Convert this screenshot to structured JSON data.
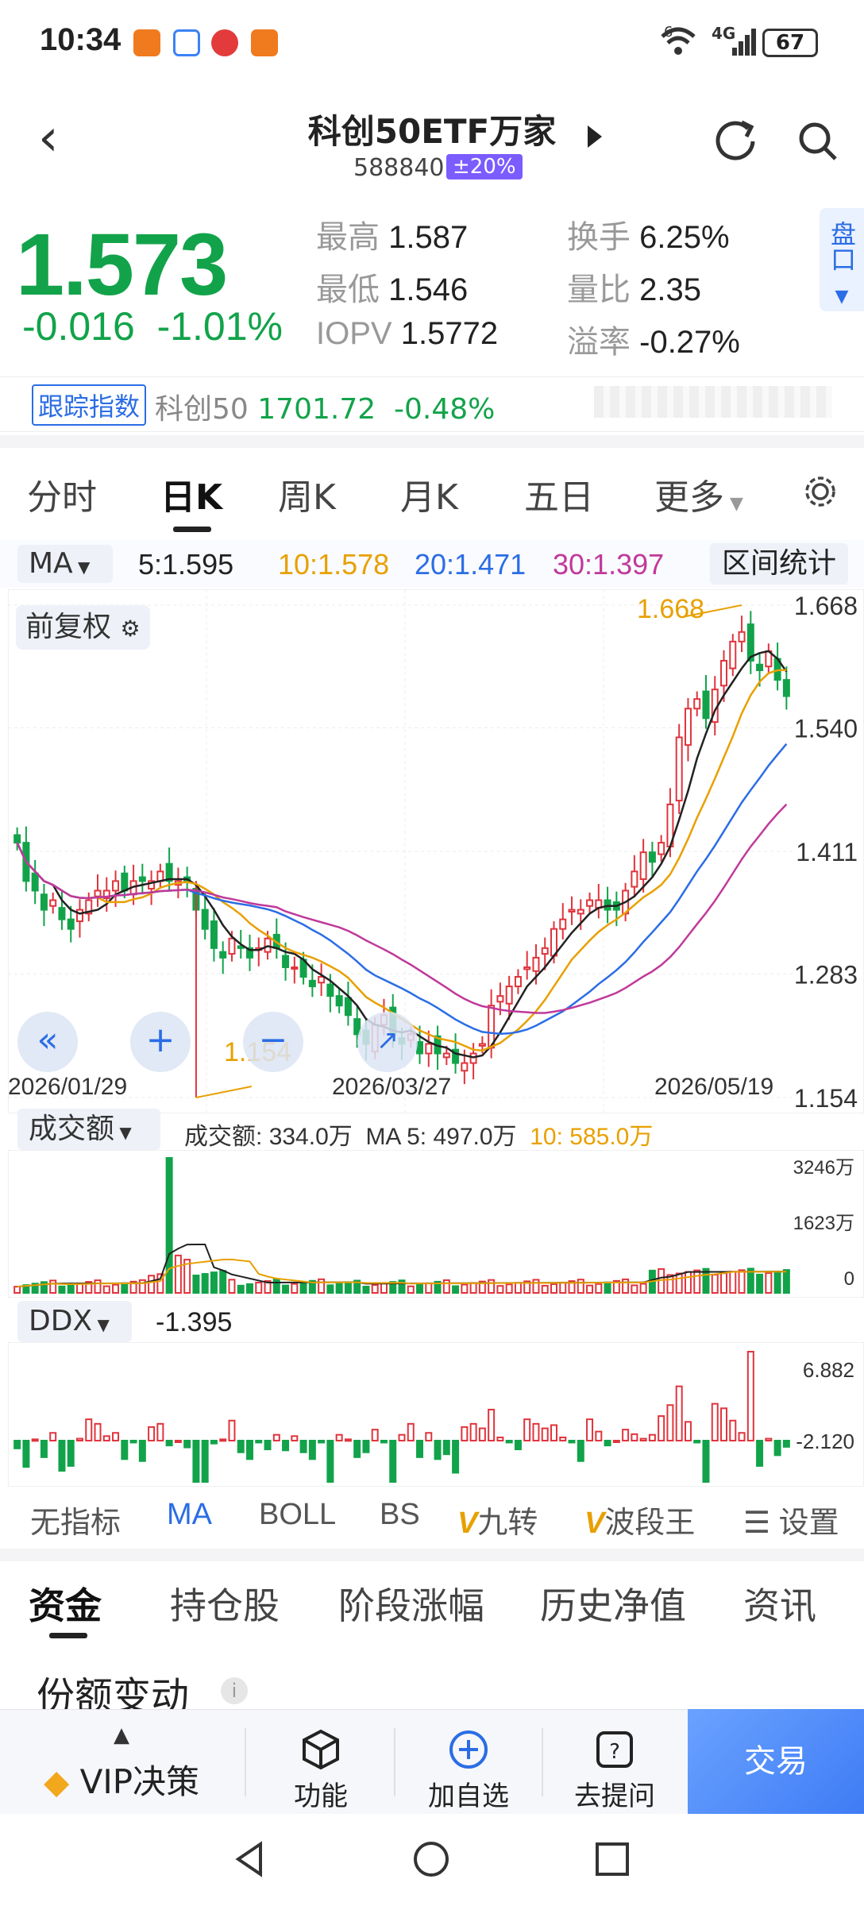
{
  "status_bar": {
    "time": "10:34",
    "network": "4G",
    "signal_label": "6",
    "battery": "67"
  },
  "header": {
    "title": "科创50ETF万家",
    "code": "588840",
    "limit_badge": "±20%"
  },
  "quote": {
    "price": "1.573",
    "change": "-0.016",
    "change_pct": "-1.01%",
    "high_label": "最高",
    "high": "1.587",
    "low_label": "最低",
    "low": "1.546",
    "iopv_label": "IOPV",
    "iopv": "1.5772",
    "turnover_label": "换手",
    "turnover": "6.25%",
    "volume_ratio_label": "量比",
    "volume_ratio": "2.35",
    "premium_label": "溢率",
    "premium": "-0.27%",
    "pankou": "盘口"
  },
  "tracking": {
    "tag": "跟踪指数",
    "index_name": "科创50",
    "index_value": "1701.72",
    "index_change": "-0.48%"
  },
  "kline_tabs": [
    "分时",
    "日K",
    "周K",
    "月K",
    "五日",
    "更多"
  ],
  "ma_bar": {
    "selector": "MA",
    "ma5": "5:1.595",
    "ma10": "10:1.578",
    "ma20": "20:1.471",
    "ma30": "30:1.397",
    "stats_button": "区间统计"
  },
  "colors": {
    "up": "#e0343c",
    "down": "#12a34a",
    "ma5": "#222222",
    "ma10": "#e8a000",
    "ma20": "#2b6de5",
    "ma30": "#c0399a",
    "accent": "#2b6de5"
  },
  "main_chart": {
    "adjust_label": "前复权",
    "y_ticks": [
      "1.668",
      "1.540",
      "1.411",
      "1.283",
      "1.154"
    ],
    "high_marker": "1.668",
    "low_marker": "1.154",
    "dates": [
      "2026/01/29",
      "2026/03/27",
      "2026/05/19"
    ]
  },
  "chart_data": {
    "type": "candlestick",
    "x_range": [
      "2026/01/29",
      "2026/05/19"
    ],
    "ylim": [
      1.154,
      1.668
    ],
    "y_ticks": [
      1.668,
      1.54,
      1.411,
      1.283,
      1.154
    ],
    "highest": 1.668,
    "lowest": 1.154,
    "close": [
      1.42,
      1.38,
      1.37,
      1.35,
      1.36,
      1.34,
      1.33,
      1.35,
      1.36,
      1.37,
      1.37,
      1.38,
      1.37,
      1.38,
      1.38,
      1.38,
      1.39,
      1.38,
      1.38,
      1.38,
      1.35,
      1.33,
      1.31,
      1.3,
      1.32,
      1.31,
      1.3,
      1.31,
      1.32,
      1.31,
      1.29,
      1.29,
      1.28,
      1.27,
      1.28,
      1.26,
      1.25,
      1.24,
      1.22,
      1.21,
      1.23,
      1.24,
      1.22,
      1.21,
      1.22,
      1.2,
      1.21,
      1.2,
      1.2,
      1.19,
      1.19,
      1.2,
      1.21,
      1.25,
      1.26,
      1.27,
      1.28,
      1.29,
      1.3,
      1.31,
      1.33,
      1.34,
      1.35,
      1.35,
      1.36,
      1.36,
      1.35,
      1.35,
      1.37,
      1.39,
      1.41,
      1.4,
      1.42,
      1.46,
      1.53,
      1.56,
      1.57,
      1.55,
      1.58,
      1.61,
      1.63,
      1.64,
      1.61,
      1.6,
      1.62,
      1.59,
      1.573
    ]
  },
  "volume": {
    "selector": "成交额",
    "label": "成交额:",
    "value": "334.0万",
    "ma5_label": "MA 5:",
    "ma5": "497.0万",
    "ma10_label": "10:",
    "ma10": "585.0万",
    "y_ticks": [
      "3246万",
      "1623万",
      "0"
    ]
  },
  "ddx": {
    "selector": "DDX",
    "value": "-1.395",
    "y_ticks": [
      "6.882",
      "-2.120"
    ]
  },
  "indicator_tabs": {
    "none": "无指标",
    "ma": "MA",
    "boll": "BOLL",
    "bs": "BS",
    "jiuzhuan": "九转",
    "boduanwang": "波段王",
    "settings": "设置",
    "v_mark": "V"
  },
  "bottom_tabs": [
    "资金",
    "持仓股",
    "阶段涨幅",
    "历史净值",
    "资讯"
  ],
  "section": {
    "title": "份额变动",
    "info": "i"
  },
  "bottom_bar": {
    "vip": "VIP决策",
    "function": "功能",
    "add_watch": "加自选",
    "ask": "去提问",
    "trade": "交易"
  }
}
